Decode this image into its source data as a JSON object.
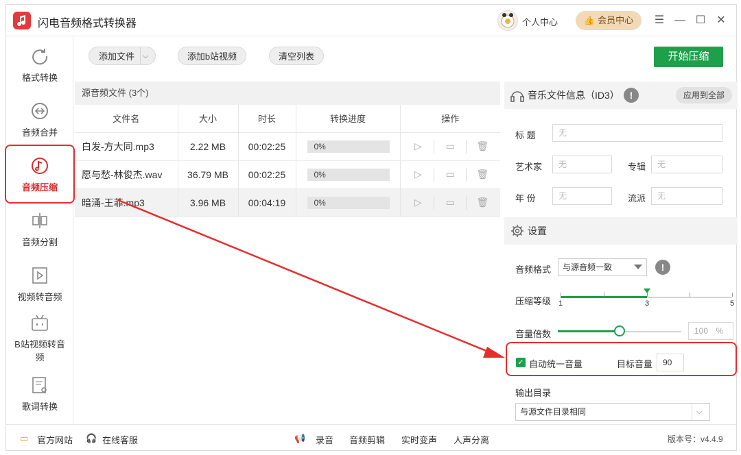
{
  "app": {
    "title": "闪电音频格式转换器",
    "personal_center": "个人中心",
    "vip_center": "会员中心"
  },
  "sidebar": {
    "items": [
      {
        "label": "格式转换",
        "icon": "refresh-icon"
      },
      {
        "label": "音频合并",
        "icon": "merge-icon"
      },
      {
        "label": "音频压缩",
        "icon": "music-note-icon"
      },
      {
        "label": "音频分割",
        "icon": "split-icon"
      },
      {
        "label": "视频转音频",
        "icon": "video-icon"
      },
      {
        "label": "B站视频转音频",
        "icon": "bilibili-icon"
      },
      {
        "label": "歌词转换",
        "icon": "lyrics-icon"
      }
    ],
    "active": "音频压缩"
  },
  "toolbar": {
    "add_file": "添加文件",
    "add_bili": "添加b站视频",
    "clear_list": "清空列表",
    "start": "开始压缩"
  },
  "file_list": {
    "header": "源音频文件 (3个)",
    "columns": [
      "文件名",
      "大小",
      "时长",
      "转换进度",
      "操作"
    ],
    "rows": [
      {
        "name": "白发-方大同.mp3",
        "size": "2.22 MB",
        "duration": "00:02:25",
        "progress": "0%"
      },
      {
        "name": "愿与愁-林俊杰.wav",
        "size": "36.79 MB",
        "duration": "00:02:25",
        "progress": "0%"
      },
      {
        "name": "暗涌-王菲.mp3",
        "size": "3.96 MB",
        "duration": "00:04:19",
        "progress": "0%"
      }
    ]
  },
  "id3": {
    "title": "音乐文件信息（ID3）",
    "apply_all": "应用到全部",
    "labels": {
      "title": "标 题",
      "artist": "艺术家",
      "album": "专辑",
      "year": "年 份",
      "genre": "流派"
    },
    "placeholder": "无"
  },
  "settings": {
    "title": "设置",
    "audio_format_label": "音频格式",
    "audio_format_value": "与源音频一致",
    "compress_level_label": "压缩等级",
    "compress_level": {
      "min": "1",
      "value": "3",
      "max": "5"
    },
    "volume_label": "音量倍数",
    "volume_value": "100",
    "volume_unit": "%",
    "volume_fraction": 0.5,
    "auto_volume_label": "自动统一音量",
    "auto_volume_checked": true,
    "target_volume_label": "目标音量",
    "target_volume_value": "90",
    "output_dir_label": "输出目录",
    "output_dir_value": "与源文件目录相同"
  },
  "footer": {
    "website": "官方网站",
    "support": "在线客服",
    "record": "录音",
    "edit": "音频剪辑",
    "realtime": "实时变声",
    "separate": "人声分离",
    "version": "版本号：v4.4.9"
  },
  "colors": {
    "accent": "#1ea04a",
    "highlight": "#e62d2d"
  }
}
